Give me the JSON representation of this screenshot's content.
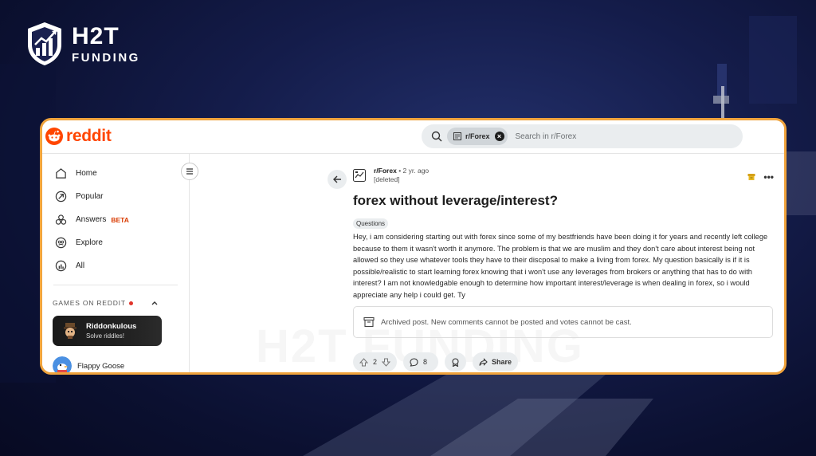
{
  "brand": {
    "name_big": "H2T",
    "name_small": "FUNDING",
    "watermark": "H2T FUNDING"
  },
  "topbar": {
    "logo_text": "reddit",
    "search_chip": "r/Forex",
    "search_placeholder": "Search in r/Forex"
  },
  "sidebar": {
    "items": [
      {
        "label": "Home",
        "icon": "home-icon"
      },
      {
        "label": "Popular",
        "icon": "popular-icon"
      },
      {
        "label": "Answers",
        "icon": "answers-icon",
        "badge": "BETA"
      },
      {
        "label": "Explore",
        "icon": "explore-icon"
      },
      {
        "label": "All",
        "icon": "all-icon"
      }
    ],
    "games_header": "GAMES ON REDDIT",
    "featured_game": {
      "title": "Riddonkulous",
      "subtitle": "Solve riddles!"
    },
    "games": [
      {
        "title": "Flappy Goose"
      }
    ]
  },
  "post": {
    "subreddit": "r/Forex",
    "age": "2 yr. ago",
    "author": "[deleted]",
    "title": "forex without leverage/interest?",
    "flair": "Questions",
    "body": "Hey, i am considering starting out with forex since some of my bestfriends have been doing it for years and recently left college because to them it wasn't worth it anymore. The problem is that we are muslim and they don't care about interest being not allowed so they use whatever tools they have to their discposal to make a living from forex. My question basically is if it is possible/realistic to start learning forex knowing that i won't use any leverages from brokers or anything that has to do with interest? I am not knowledgable enough to determine how important interest/leverage is when dealing in forex, so i would appreciate any help i could get. Ty",
    "archived_notice": "Archived post. New comments cannot be posted and votes cannot be cast.",
    "votes": "2",
    "comments": "8",
    "share_label": "Share"
  },
  "colors": {
    "accent_orange": "#ff4500",
    "frame_border": "#f0a33c",
    "beta_red": "#d93a00"
  }
}
